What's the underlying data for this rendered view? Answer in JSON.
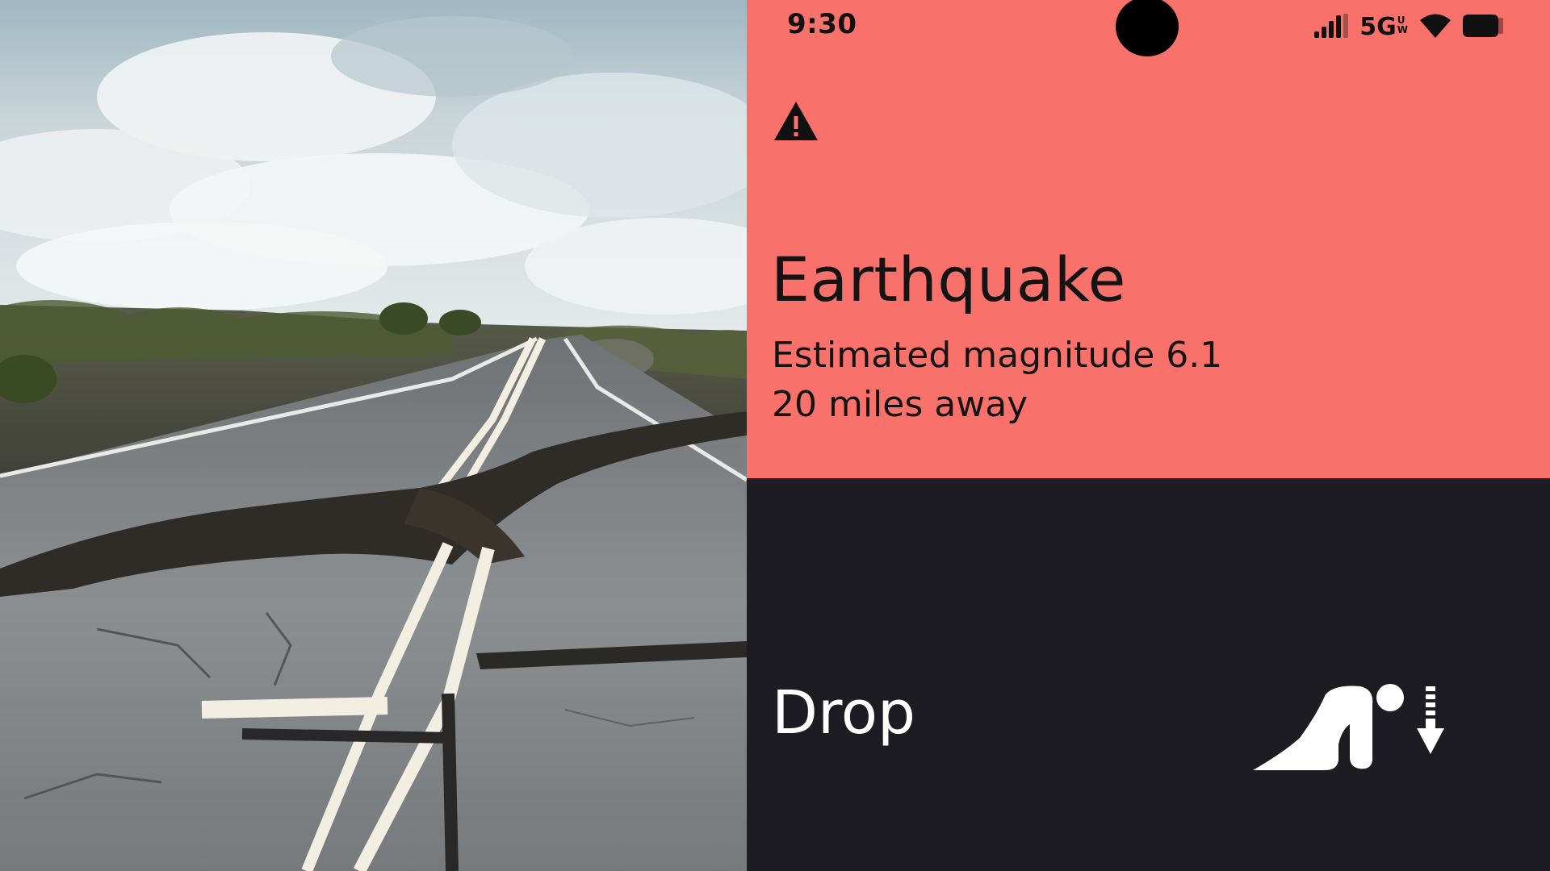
{
  "status_bar": {
    "time": "9:30",
    "network_label": "5G",
    "network_suffix_top": "U",
    "network_suffix_bottom": "W",
    "icons": [
      "signal-icon",
      "wifi-icon",
      "battery-icon"
    ]
  },
  "alert": {
    "icon": "warning-icon",
    "title": "Earthquake",
    "magnitude_text": "Estimated magnitude 6.1",
    "distance_text": "20 miles away"
  },
  "action": {
    "label": "Drop",
    "icon": "drop-cover-figure-icon",
    "arrow_icon": "down-arrow-icon"
  },
  "colors": {
    "alert_background": "#f8716b",
    "action_background": "#1c1c22",
    "alert_text": "#141414",
    "action_text": "#ffffff"
  }
}
